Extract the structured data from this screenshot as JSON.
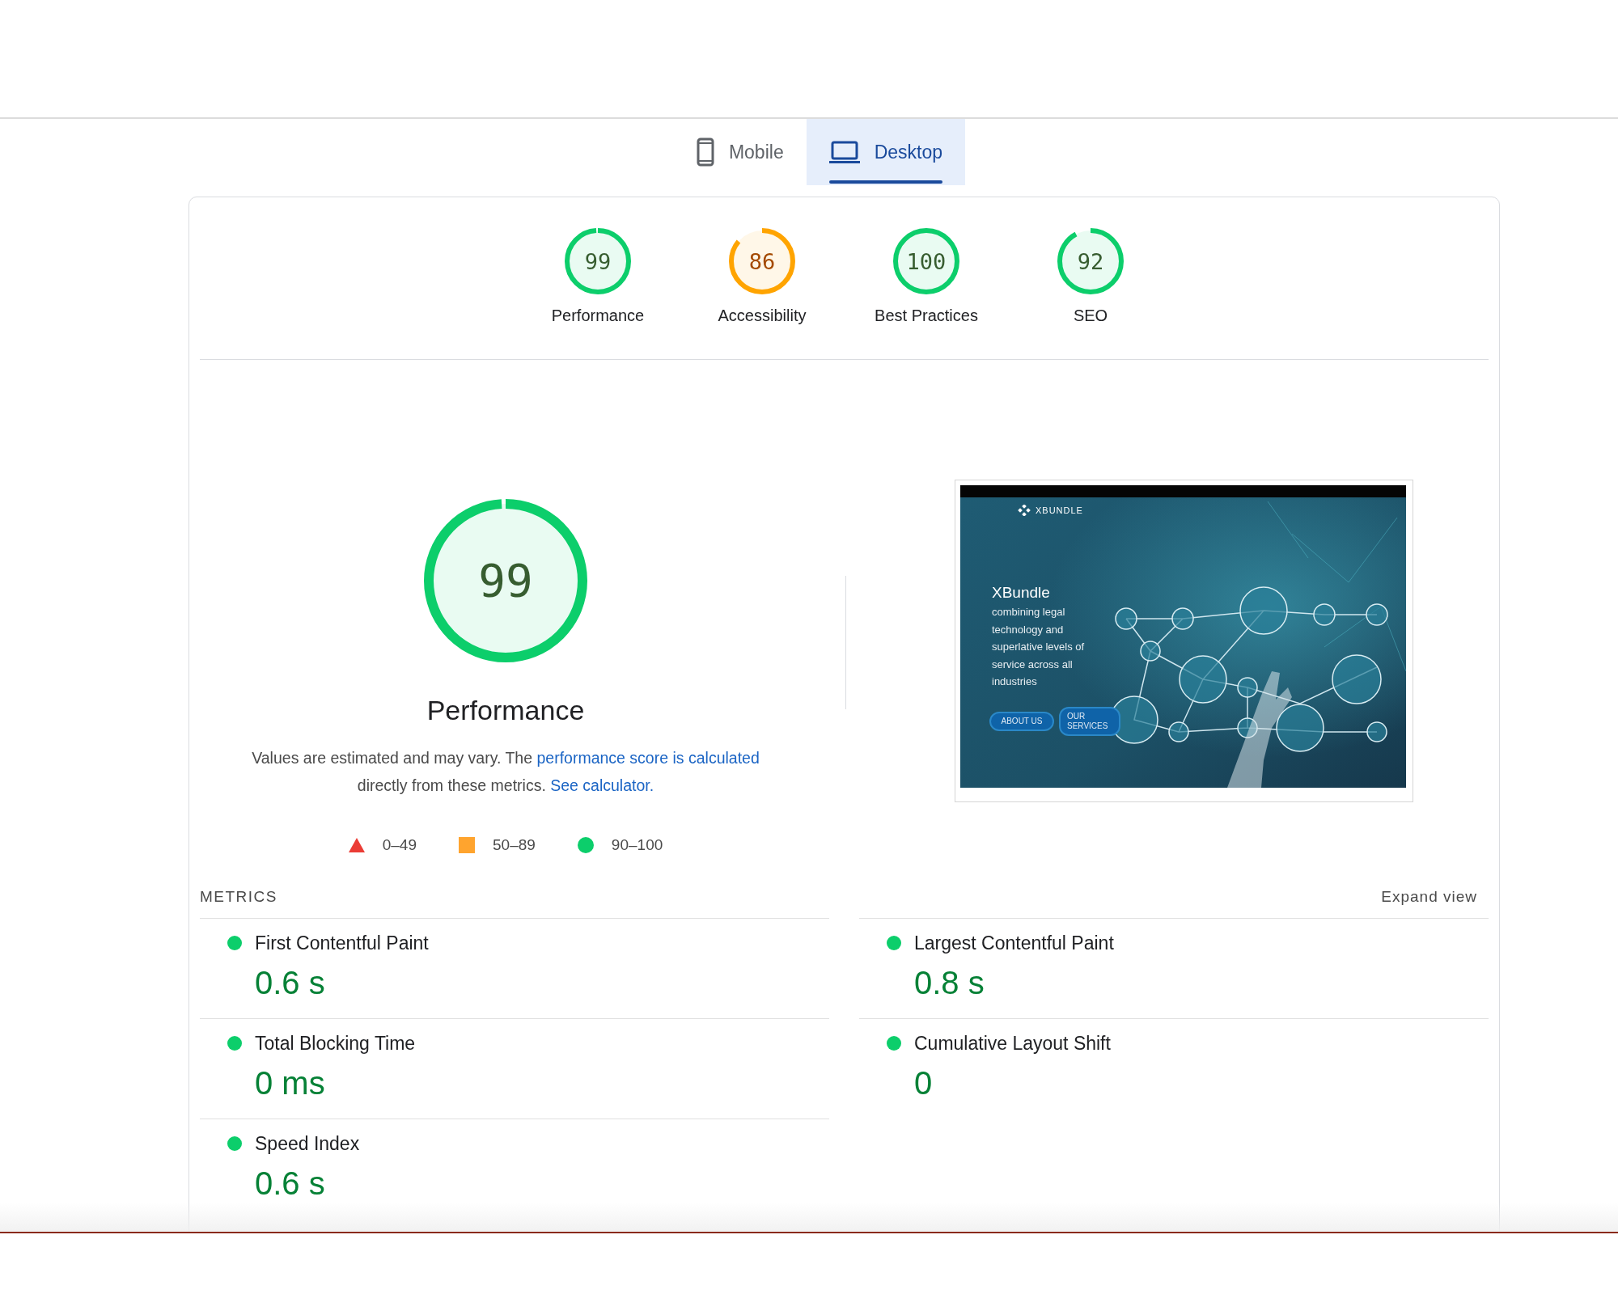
{
  "tabs": [
    {
      "label": "Mobile",
      "kind": "phone",
      "selected": false
    },
    {
      "label": "Desktop",
      "kind": "laptop",
      "selected": true
    }
  ],
  "categories": [
    {
      "score": "99",
      "label": "Performance",
      "level": 0.99,
      "color": "#0cce6b"
    },
    {
      "score": "86",
      "label": "Accessibility",
      "level": 0.86,
      "color": "#ffa400"
    },
    {
      "score": "100",
      "label": "Best Practices",
      "level": 1,
      "color": "#0cce6b"
    },
    {
      "score": "92",
      "label": "SEO",
      "level": 0.92,
      "color": "#0cce6b"
    }
  ],
  "performance": {
    "score": "99",
    "level": 0.99,
    "color": "#0cce6b",
    "title": "Performance",
    "description": [
      {
        "kind": "text",
        "text": "Values are estimated and may vary. The "
      },
      {
        "kind": "link",
        "text": "performance score is calculated"
      },
      {
        "kind": "text",
        "text": " directly from these metrics. "
      },
      {
        "kind": "link",
        "text": "See calculator."
      }
    ]
  },
  "legend": [
    {
      "kind": "triangle",
      "label": "0–49"
    },
    {
      "kind": "square",
      "label": "50–89"
    },
    {
      "kind": "circle",
      "label": "90–100"
    }
  ],
  "screenshot": {
    "logo": "XBUNDLE",
    "heading": "XBundle",
    "tagline": "combining legal technology and superlative levels of service across all industries",
    "buttons": [
      "ABOUT US",
      "OUR SERVICES"
    ]
  },
  "metrics": {
    "title": "METRICS",
    "expand": "Expand view",
    "items": [
      {
        "label": "First Contentful Paint",
        "value": "0.6 s",
        "color": "#0cce6b"
      },
      {
        "label": "Largest Contentful Paint",
        "value": "0.8 s",
        "color": "#0cce6b"
      },
      {
        "label": "Total Blocking Time",
        "value": "0 ms",
        "color": "#0cce6b"
      },
      {
        "label": "Cumulative Layout Shift",
        "value": "0",
        "color": "#0cce6b"
      },
      {
        "label": "Speed Index",
        "value": "0.6 s",
        "color": "#0cce6b"
      }
    ]
  }
}
